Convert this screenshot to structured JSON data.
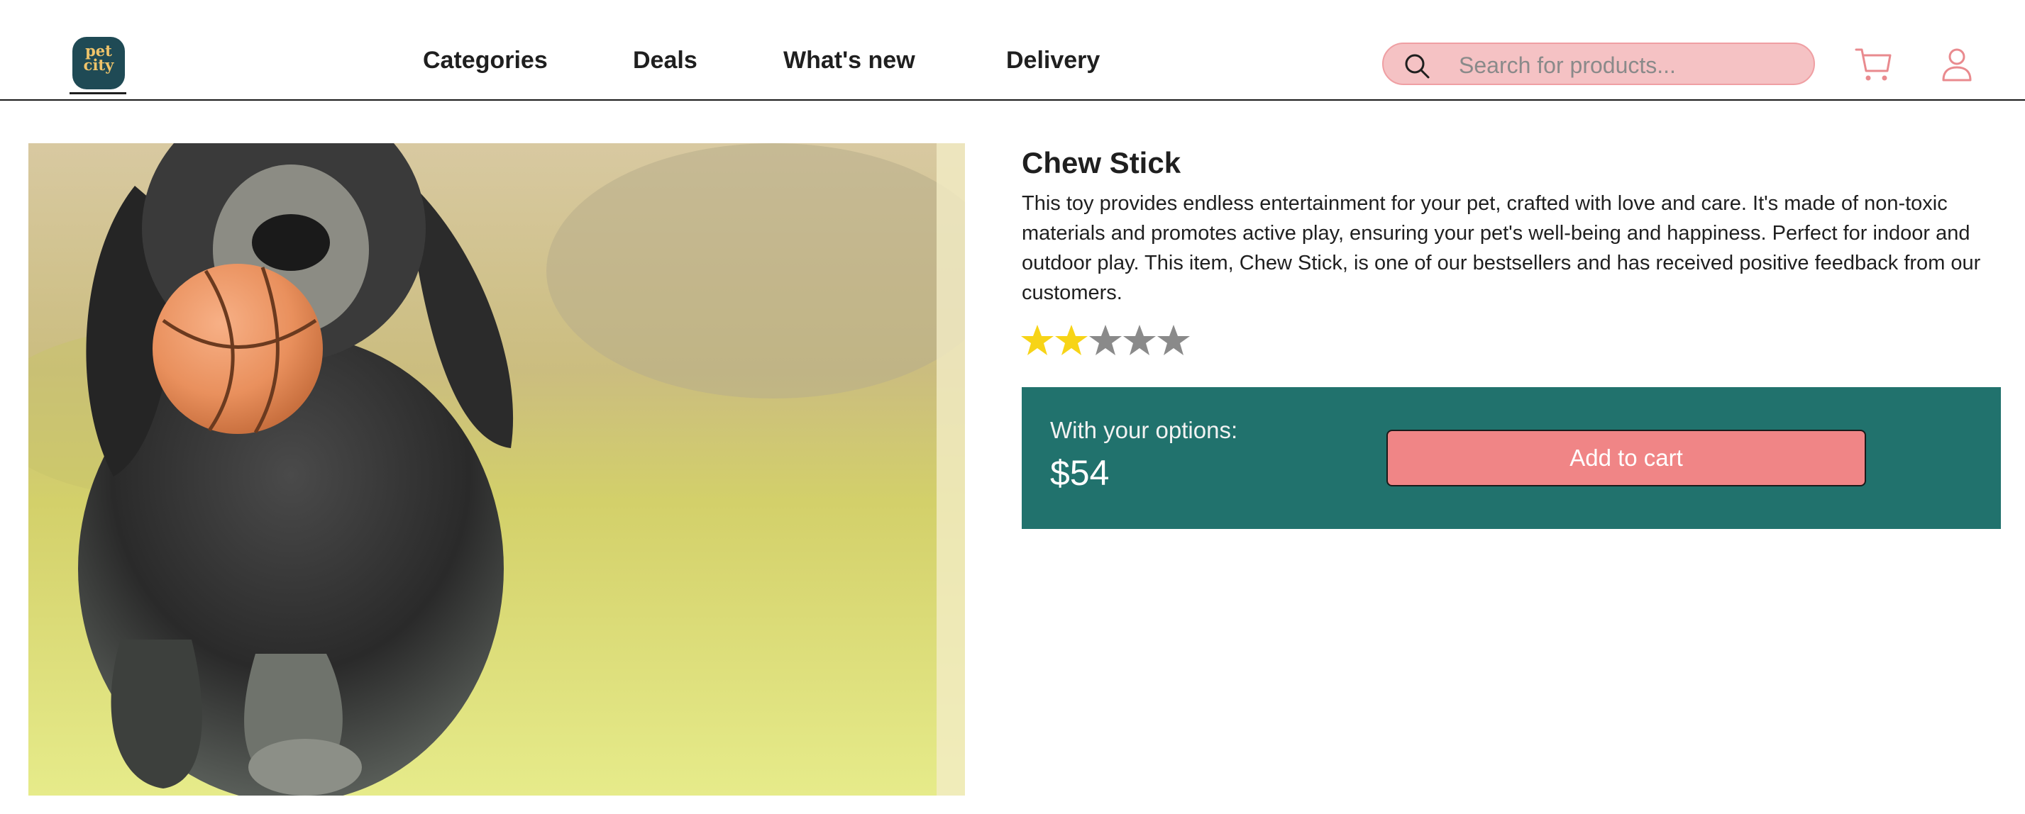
{
  "header": {
    "logo": {
      "text_line1": "pet",
      "text_line2": "city",
      "icon": "pet-city-logo"
    },
    "nav": [
      {
        "label": "Categories"
      },
      {
        "label": "Deals"
      },
      {
        "label": "What's new"
      },
      {
        "label": "Delivery"
      }
    ],
    "search": {
      "placeholder": "Search for products...",
      "value": "",
      "icon": "search-icon"
    },
    "cart_icon": "cart-icon",
    "user_icon": "user-icon"
  },
  "product": {
    "image": "dog-with-ball-photo",
    "title": "Chew Stick",
    "description": "This toy provides endless entertainment for your pet, crafted with love and care. It's made of non-toxic materials and promotes active play, ensuring your pet's well-being and happiness. Perfect for indoor and outdoor play. This item, Chew Stick, is one of our bestsellers and has received positive feedback from our customers.",
    "rating": {
      "value": 2,
      "max": 5
    },
    "options_label": "With your options:",
    "price": "$54",
    "add_to_cart_label": "Add to cart"
  },
  "colors": {
    "accent_panel": "#21726d",
    "button": "#f08586",
    "search_bg": "#f5c2c4",
    "icon_pink": "#e98a8e",
    "star_filled": "#f7d417",
    "star_empty": "#8a8a8a"
  }
}
